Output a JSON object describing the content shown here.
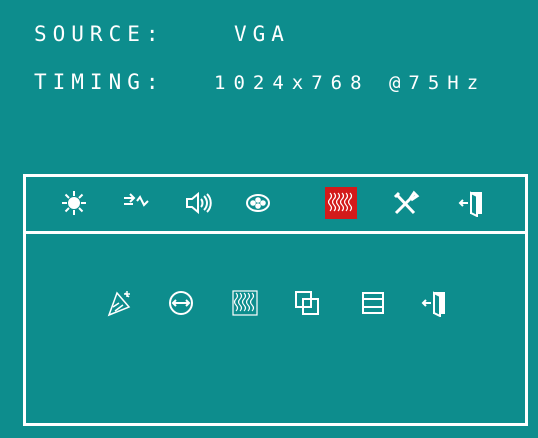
{
  "info": {
    "source_label": "SOURCE:",
    "source_value": "VGA",
    "timing_label": "TIMING:",
    "timing_value": "1024x768 @75Hz"
  },
  "main_menu": {
    "items": [
      {
        "icon": "brightness-icon"
      },
      {
        "icon": "input-signal-icon"
      },
      {
        "icon": "audio-icon"
      },
      {
        "icon": "color-icon"
      },
      {
        "icon": "image-adjust-icon",
        "selected": true
      },
      {
        "icon": "tools-icon"
      },
      {
        "icon": "exit-icon"
      }
    ]
  },
  "sub_menu": {
    "items": [
      {
        "icon": "auto-adjust-icon"
      },
      {
        "icon": "clock-icon"
      },
      {
        "icon": "phase-icon"
      },
      {
        "icon": "h-position-icon"
      },
      {
        "icon": "v-position-icon"
      },
      {
        "icon": "exit-icon"
      }
    ]
  },
  "colors": {
    "background": "#0d8d8d",
    "foreground": "#ffffff",
    "selection": "#d31a1a"
  }
}
